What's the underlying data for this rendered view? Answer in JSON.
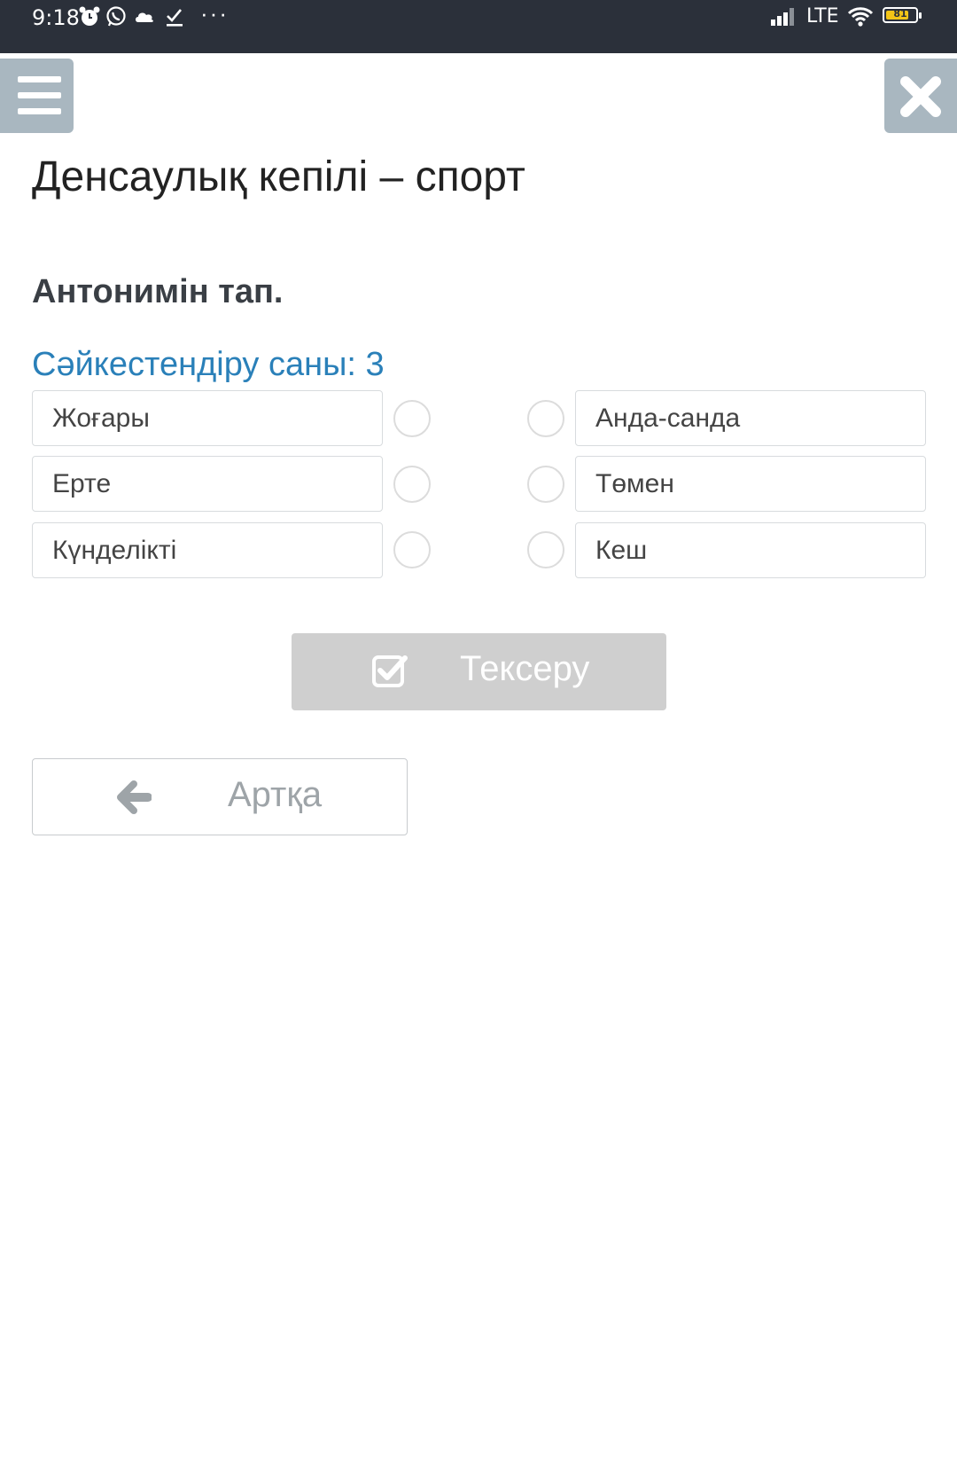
{
  "status_bar": {
    "time": "9:18",
    "icons": [
      "alarm-icon",
      "whatsapp-icon",
      "cloud-icon",
      "download-done-icon",
      "more-dots-icon",
      "signal-icon",
      "wifi-icon",
      "battery-icon"
    ],
    "more": "···",
    "network": "LTE",
    "battery_level": "81",
    "battery_fraction": 0.81
  },
  "toolbar": {
    "menu_icon": "menu-icon",
    "close_icon": "close-icon"
  },
  "lesson": {
    "title": "Денсаулық кепілі – спорт"
  },
  "task": {
    "question": "Антонимін тап.",
    "match_count": "Сәйкестендіру саны: 3",
    "left_items": [
      "Жоғары",
      "Ерте",
      "Күнделікті"
    ],
    "right_items": [
      "Анда-санда",
      "Төмен",
      "Кеш"
    ]
  },
  "actions": {
    "check_label": "Тексеру",
    "check_icon": "checkbox-checked-icon",
    "back_label": "Артқа",
    "back_icon": "arrow-left-icon"
  },
  "colors": {
    "status_bar_bg": "#2b303a",
    "toolbar_button_bg": "#a9b7c0",
    "accent_blue": "#2a80b9",
    "disabled_button_bg": "#cfcfcf"
  }
}
